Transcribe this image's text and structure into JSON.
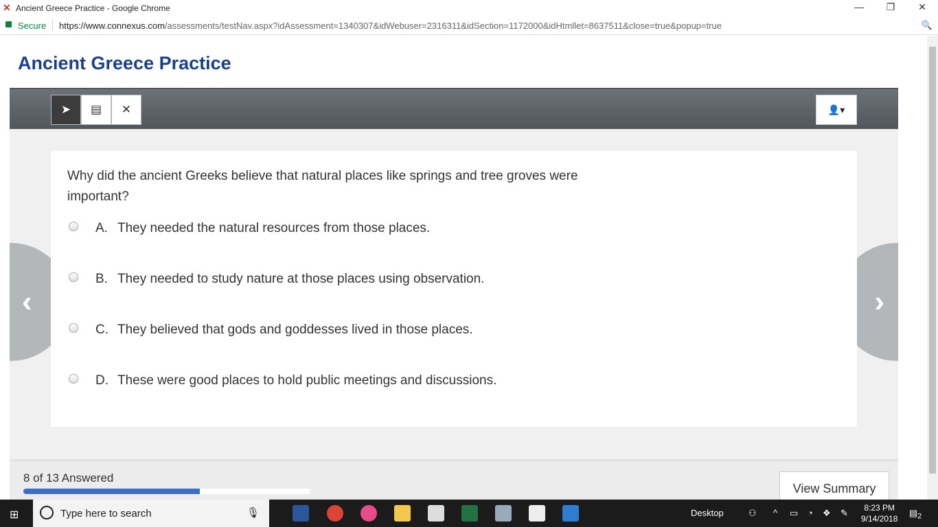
{
  "browser": {
    "window_title": "Ancient Greece Practice - Google Chrome",
    "secure_label": "Secure",
    "url_host": "https://www.connexus.com",
    "url_path": "/assessments/testNav.aspx?idAssessment=1340307&idWebuser=2316311&idSection=1172000&idHtmllet=8637511&close=true&popup=true"
  },
  "page": {
    "title": "Ancient Greece Practice"
  },
  "toolbar": {
    "tools": [
      "pointer-icon",
      "note-icon",
      "eliminate-icon"
    ],
    "active_tool": "pointer"
  },
  "question": {
    "text": "Why did the ancient Greeks believe that natural places like springs and tree groves were important?",
    "options": [
      {
        "letter": "A.",
        "text": "They needed the natural resources from those places."
      },
      {
        "letter": "B.",
        "text": "They needed to study nature at those places using observation."
      },
      {
        "letter": "C.",
        "text": "They believed that gods and goddesses lived in those places."
      },
      {
        "letter": "D.",
        "text": "These were good places to hold public meetings and discussions."
      }
    ],
    "selected": null
  },
  "footer": {
    "answered_text": "8 of 13 Answered",
    "answered": 8,
    "total": 13,
    "view_summary": "View Summary"
  },
  "taskbar": {
    "search_placeholder": "Type here to search",
    "desktop_label": "Desktop",
    "time": "8:23 PM",
    "date": "9/14/2018",
    "notifications": "2"
  },
  "colors": {
    "title": "#1a3f8c",
    "progress": "#3a6fc4"
  }
}
